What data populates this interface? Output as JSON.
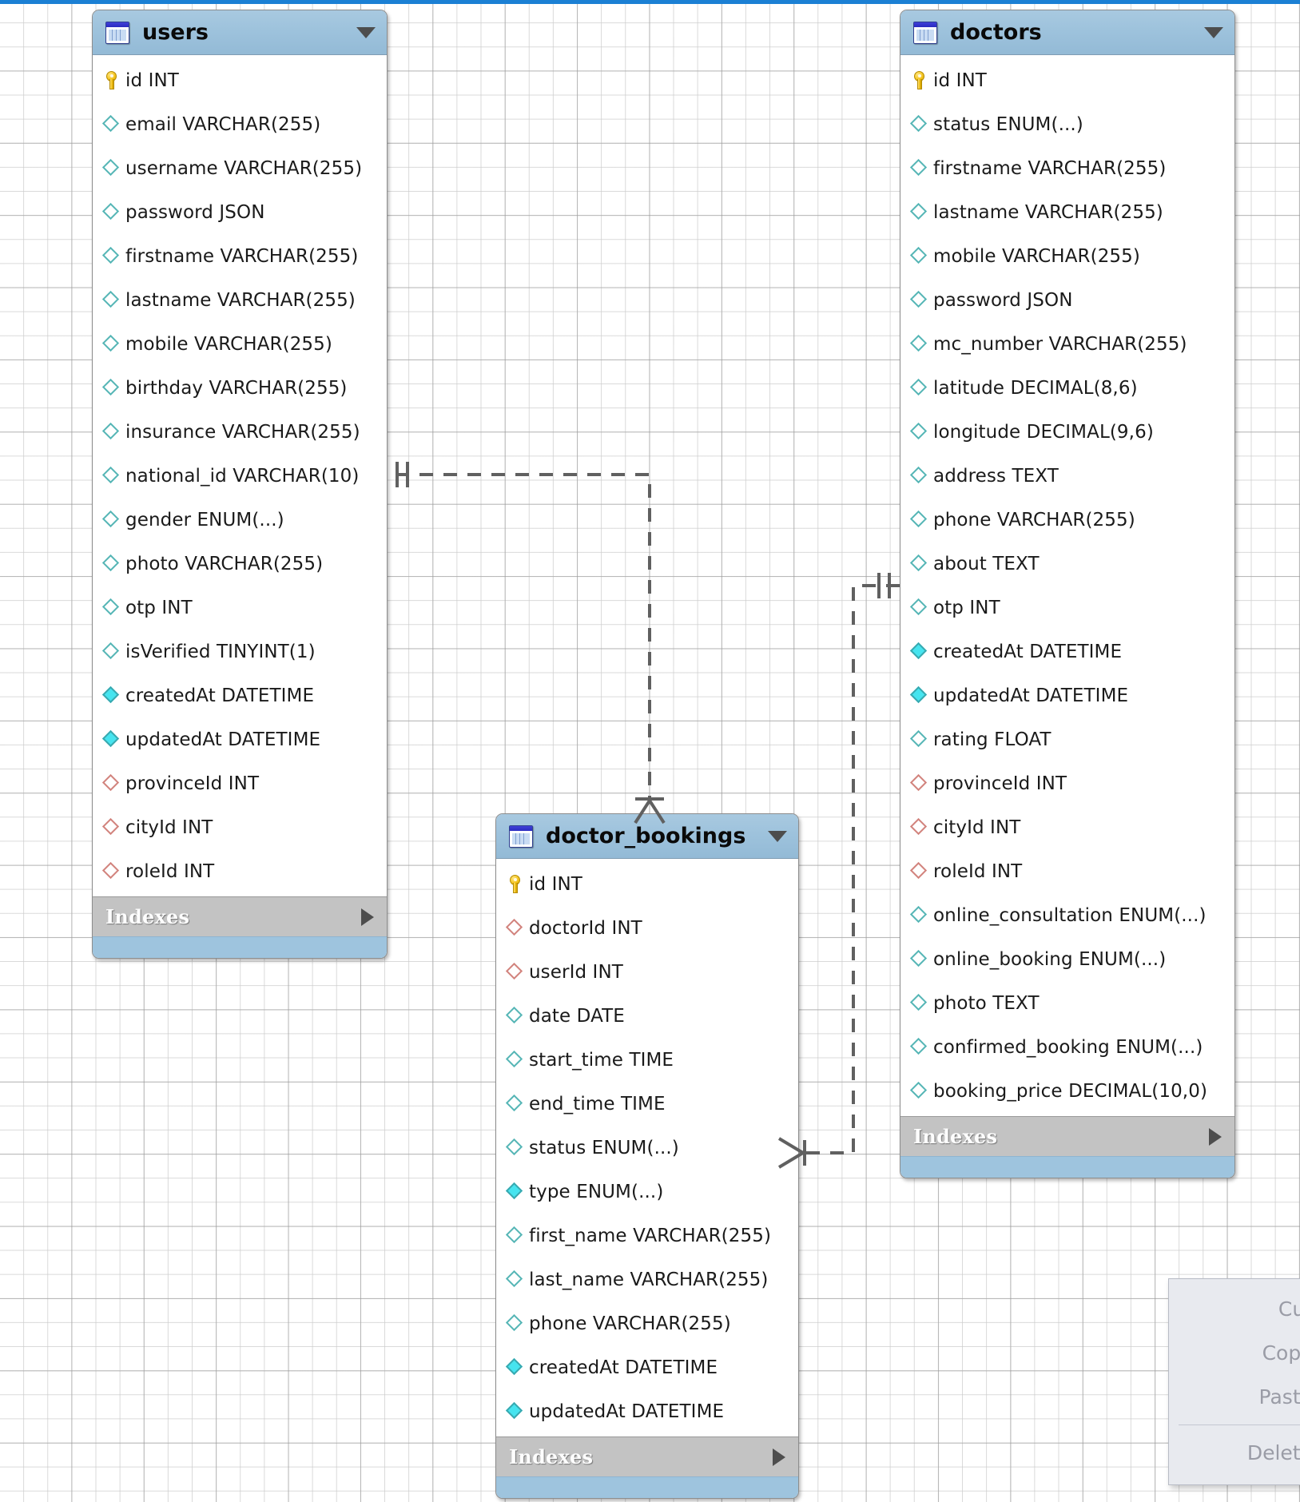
{
  "app": {
    "kind": "eer-diagram",
    "accent_color": "#1b80d4",
    "header_color": "#9dc2dc",
    "indexes_label": "Indexes"
  },
  "tables": [
    {
      "id": "users",
      "name": "users",
      "icon": "table-icon",
      "indexes_label": "Indexes",
      "columns": [
        {
          "label": "id INT",
          "marker": "pk"
        },
        {
          "label": "email VARCHAR(255)",
          "marker": "nullable"
        },
        {
          "label": "username VARCHAR(255)",
          "marker": "nullable"
        },
        {
          "label": "password JSON",
          "marker": "nullable"
        },
        {
          "label": "firstname VARCHAR(255)",
          "marker": "nullable"
        },
        {
          "label": "lastname VARCHAR(255)",
          "marker": "nullable"
        },
        {
          "label": "mobile VARCHAR(255)",
          "marker": "nullable"
        },
        {
          "label": "birthday VARCHAR(255)",
          "marker": "nullable"
        },
        {
          "label": "insurance VARCHAR(255)",
          "marker": "nullable"
        },
        {
          "label": "national_id VARCHAR(10)",
          "marker": "nullable"
        },
        {
          "label": "gender ENUM(...)",
          "marker": "nullable"
        },
        {
          "label": "photo VARCHAR(255)",
          "marker": "nullable"
        },
        {
          "label": "otp INT",
          "marker": "nullable"
        },
        {
          "label": "isVerified TINYINT(1)",
          "marker": "nullable"
        },
        {
          "label": "createdAt DATETIME",
          "marker": "notnull"
        },
        {
          "label": "updatedAt DATETIME",
          "marker": "notnull"
        },
        {
          "label": "provinceId INT",
          "marker": "fk"
        },
        {
          "label": "cityId INT",
          "marker": "fk"
        },
        {
          "label": "roleId INT",
          "marker": "fk"
        }
      ]
    },
    {
      "id": "doctors",
      "name": "doctors",
      "icon": "table-icon",
      "indexes_label": "Indexes",
      "columns": [
        {
          "label": "id INT",
          "marker": "pk"
        },
        {
          "label": "status ENUM(...)",
          "marker": "nullable"
        },
        {
          "label": "firstname VARCHAR(255)",
          "marker": "nullable"
        },
        {
          "label": "lastname VARCHAR(255)",
          "marker": "nullable"
        },
        {
          "label": "mobile VARCHAR(255)",
          "marker": "nullable"
        },
        {
          "label": "password JSON",
          "marker": "nullable"
        },
        {
          "label": "mc_number VARCHAR(255)",
          "marker": "nullable"
        },
        {
          "label": "latitude DECIMAL(8,6)",
          "marker": "nullable"
        },
        {
          "label": "longitude DECIMAL(9,6)",
          "marker": "nullable"
        },
        {
          "label": "address TEXT",
          "marker": "nullable"
        },
        {
          "label": "phone VARCHAR(255)",
          "marker": "nullable"
        },
        {
          "label": "about TEXT",
          "marker": "nullable"
        },
        {
          "label": "otp INT",
          "marker": "nullable"
        },
        {
          "label": "createdAt DATETIME",
          "marker": "notnull"
        },
        {
          "label": "updatedAt DATETIME",
          "marker": "notnull"
        },
        {
          "label": "rating FLOAT",
          "marker": "nullable"
        },
        {
          "label": "provinceId INT",
          "marker": "fk"
        },
        {
          "label": "cityId INT",
          "marker": "fk"
        },
        {
          "label": "roleId INT",
          "marker": "fk"
        },
        {
          "label": "online_consultation ENUM(...)",
          "marker": "nullable"
        },
        {
          "label": "online_booking ENUM(...)",
          "marker": "nullable"
        },
        {
          "label": "photo TEXT",
          "marker": "nullable"
        },
        {
          "label": "confirmed_booking ENUM(...)",
          "marker": "nullable"
        },
        {
          "label": "booking_price DECIMAL(10,0)",
          "marker": "nullable"
        }
      ]
    },
    {
      "id": "doctor_bookings",
      "name": "doctor_bookings",
      "icon": "table-icon",
      "indexes_label": "Indexes",
      "columns": [
        {
          "label": "id INT",
          "marker": "pk"
        },
        {
          "label": "doctorId INT",
          "marker": "fk"
        },
        {
          "label": "userId INT",
          "marker": "fk"
        },
        {
          "label": "date DATE",
          "marker": "nullable"
        },
        {
          "label": "start_time TIME",
          "marker": "nullable"
        },
        {
          "label": "end_time TIME",
          "marker": "nullable"
        },
        {
          "label": "status ENUM(...)",
          "marker": "nullable"
        },
        {
          "label": "type ENUM(...)",
          "marker": "notnull"
        },
        {
          "label": "first_name VARCHAR(255)",
          "marker": "nullable"
        },
        {
          "label": "last_name VARCHAR(255)",
          "marker": "nullable"
        },
        {
          "label": "phone VARCHAR(255)",
          "marker": "nullable"
        },
        {
          "label": "createdAt DATETIME",
          "marker": "notnull"
        },
        {
          "label": "updatedAt DATETIME",
          "marker": "notnull"
        }
      ]
    }
  ],
  "relationships": [
    {
      "id": "users-doctor_bookings",
      "from_table": "users",
      "to_table": "doctor_bookings",
      "style": "identifying-dashed",
      "from_cardinality": "one",
      "to_cardinality": "many"
    },
    {
      "id": "doctors-doctor_bookings",
      "from_table": "doctors",
      "to_table": "doctor_bookings",
      "style": "identifying-dashed",
      "from_cardinality": "one",
      "to_cardinality": "many"
    }
  ],
  "context_menu": {
    "items": [
      {
        "label": "Cut",
        "enabled": false
      },
      {
        "label": "Copy",
        "enabled": false
      },
      {
        "label": "Paste",
        "enabled": false
      },
      {
        "label": "Delete",
        "enabled": false
      }
    ]
  }
}
